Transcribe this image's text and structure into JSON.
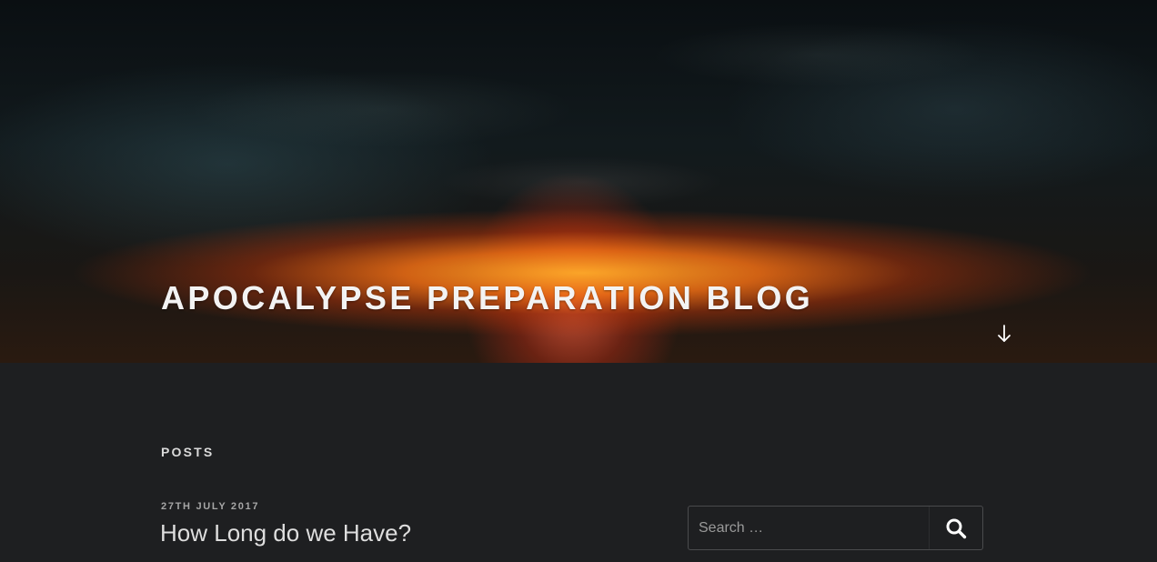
{
  "header": {
    "site_title": "APOCALYPSE PREPARATION BLOG",
    "scroll_icon": "arrow-down-icon"
  },
  "main": {
    "section_title": "POSTS",
    "posts": [
      {
        "date": "27TH JULY 2017",
        "title": "How Long do we Have?"
      }
    ]
  },
  "sidebar": {
    "search": {
      "placeholder": "Search …",
      "value": "",
      "button_icon": "search-icon"
    }
  },
  "colors": {
    "background": "#1e1f21",
    "title_text": "#f3f3f3",
    "meta_text": "#a6a6a6"
  }
}
